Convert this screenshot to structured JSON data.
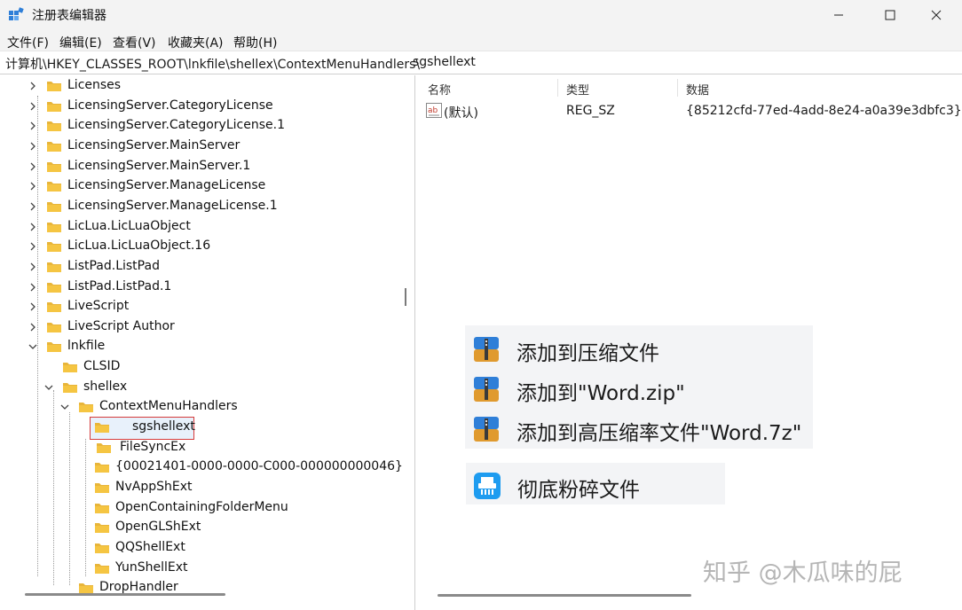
{
  "window": {
    "title": "注册表编辑器",
    "controls": {
      "minimize": "minimize",
      "maximize": "maximize",
      "close": "close"
    }
  },
  "menu": [
    "文件(F)",
    "编辑(E)",
    "查看(V)",
    "收藏夹(A)",
    "帮助(H)"
  ],
  "address": {
    "path": "计算机\\HKEY_CLASSES_ROOT\\lnkfile\\shellex\\ContextMenuHandlers\\",
    "last": "sgshellext"
  },
  "tree": {
    "items": [
      "Licenses",
      "LicensingServer.CategoryLicense",
      "LicensingServer.CategoryLicense.1",
      "LicensingServer.MainServer",
      "LicensingServer.MainServer.1",
      "LicensingServer.ManageLicense",
      "LicensingServer.ManageLicense.1",
      "LicLua.LicLuaObject",
      "LicLua.LicLuaObject.16",
      "ListPad.ListPad",
      "ListPad.ListPad.1",
      "LiveScript",
      "LiveScript Author",
      "lnkfile",
      "CLSID",
      "shellex",
      "ContextMenuHandlers",
      "sgshellext",
      "FileSyncEx",
      "{00021401-0000-0000-C000-000000000046}",
      "NvAppShExt",
      "OpenContainingFolderMenu",
      "OpenGLShExt",
      "QQShellExt",
      "YunShellExt",
      "DropHandler"
    ],
    "selected": "sgshellext"
  },
  "values": {
    "headers": {
      "name": "名称",
      "type": "类型",
      "data": "数据"
    },
    "rows": [
      {
        "name": "(默认)",
        "type": "REG_SZ",
        "data": "{85212cfd-77ed-4add-8e24-a0a39e3dbfc3}"
      }
    ]
  },
  "context_menu": {
    "items": [
      "添加到压缩文件",
      "添加到\"Word.zip\"",
      "添加到高压缩率文件\"Word.7z\""
    ],
    "shred": "彻底粉碎文件"
  },
  "watermark": "知乎 @木瓜味的屁",
  "colors": {
    "folder": "#f5c542",
    "selection_border": "#d63b3b",
    "selection_fill": "#e8f1fb",
    "panel": "#f3f4f6"
  }
}
